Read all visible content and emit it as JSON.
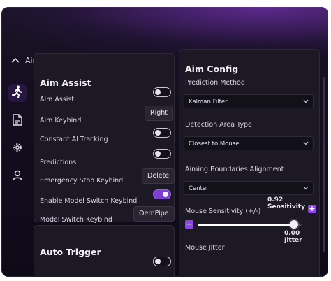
{
  "app": {
    "title": "Aimmy"
  },
  "sidebar": {
    "items": [
      {
        "icon": "running-person-icon",
        "label": "Aim"
      },
      {
        "icon": "file-icon",
        "label": "Models"
      },
      {
        "icon": "gear-icon",
        "label": "Settings"
      },
      {
        "icon": "user-icon",
        "label": "Account"
      }
    ]
  },
  "aim_assist": {
    "title": "Aim Assist",
    "rows": {
      "aim_assist": {
        "label": "Aim Assist",
        "on": false
      },
      "aim_keybind": {
        "label": "Aim Keybind",
        "value": "Right"
      },
      "constant_tracking": {
        "label": "Constant AI Tracking",
        "on": false
      },
      "predictions": {
        "label": "Predictions",
        "on": false
      },
      "emergency_stop": {
        "label": "Emergency Stop Keybind",
        "value": "Delete"
      },
      "enable_model_switch": {
        "label": "Enable Model Switch Keybind",
        "on": true
      },
      "model_switch": {
        "label": "Model Switch Keybind",
        "value": "OemPipe"
      }
    }
  },
  "auto_trigger": {
    "title": "Auto Trigger"
  },
  "aim_config": {
    "title": "Aim Config",
    "prediction_method": {
      "label": "Prediction Method",
      "value": "Kalman Filter"
    },
    "detection_area": {
      "label": "Detection Area Type",
      "value": "Closest to Mouse"
    },
    "aiming_alignment": {
      "label": "Aiming Boundaries Alignment",
      "value": "Center"
    },
    "mouse_sensitivity": {
      "label": "Mouse Sensitivity (+/-)",
      "value_text": "0.92 Sensitivity",
      "fraction": 0.92
    },
    "mouse_jitter": {
      "label": "Mouse Jitter",
      "value_text": "0.00 Jitter"
    }
  },
  "colors": {
    "accent": "#8e44ec",
    "panel": "#1c1924",
    "background": "#130d1e"
  }
}
